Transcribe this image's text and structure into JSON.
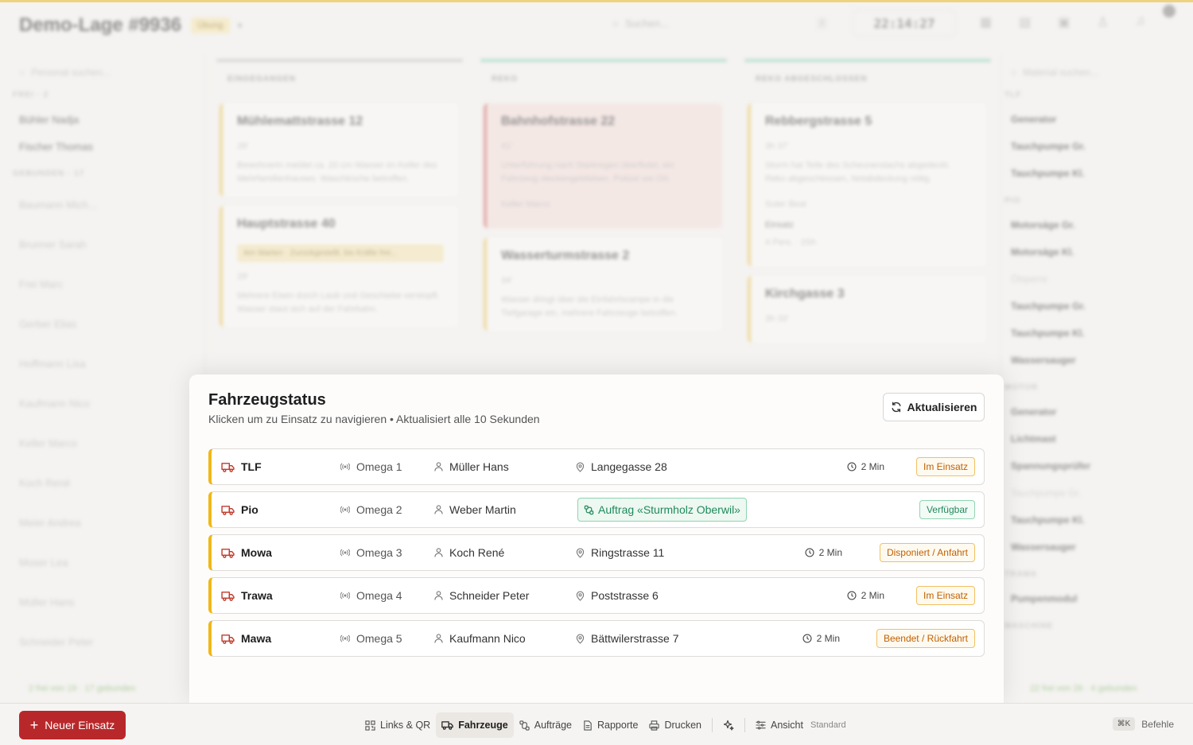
{
  "background": {
    "title": "Demo-Lage #9936",
    "badge": "Übung",
    "search_placeholder": "Suchen...",
    "clock": "22:14:27",
    "personnel_search": "Personal suchen...",
    "material_search": "Material suchen...",
    "sections": [
      "FREI · 2",
      "GEBUNDEN · 17"
    ],
    "free_people": [
      "Bühler Nadja",
      "Fischer Thomas"
    ],
    "bound_people": [
      "Baumann Mich...",
      "Brunner Sarah",
      "Frei Marc",
      "Gerber Elias",
      "Hoffmann Lisa",
      "Kaufmann Nico",
      "Keller Marco",
      "Koch René",
      "Meier Andrea",
      "Moser Lea",
      "Müller Hans",
      "Schneider Peter"
    ],
    "left_footer": "2 frei von 19 · 17 gebunden",
    "columns": [
      {
        "title": "EINGEGANGEN",
        "cards": [
          {
            "title": "Mühlemattstrasse 12",
            "meta": "28'",
            "text": "Bewohnerin meldet ca. 20 cm Wasser im Keller des Mehrfamilienhauses. Waschküche betroffen."
          },
          {
            "title": "Hauptstrasse 40",
            "warn": "Am Warten · Zurückgestellt, bis Kräfte frei...",
            "meta": "29'",
            "text": "Mehrere Eisen durch Laub und Geschiebe verstopft. Wasser staut sich auf der Fahrbahn."
          }
        ]
      },
      {
        "title": "REKO",
        "cards": [
          {
            "title": "Bahnhofstrasse 22",
            "meta": "41'",
            "text": "Unterführung nach Starkregen überflutet, ein Fahrzeug steckengeblieben. Polizei vor Ort.",
            "person": "Keller Marco"
          },
          {
            "title": "Wasserturmstrasse 2",
            "meta": "34'",
            "text": "Wasser dringt über die Einfahrtsrampe in die Tiefgarage ein, mehrere Fahrzeuge betroffen."
          }
        ]
      },
      {
        "title": "REKO ABGESCHLOSSEN",
        "cards": [
          {
            "title": "Rebbergstrasse 5",
            "meta": "3h 37'",
            "text": "Sturm hat Teile des Scheunendachs abgedeckt. Reko abgeschlossen, Notabdeckung nötig.",
            "person": "Suter Beat",
            "extra": "Einsatz",
            "extra_sub": "4 Pers. · 2Sh"
          },
          {
            "title": "Kirchgasse 3",
            "meta": "3h 33'"
          }
        ]
      }
    ],
    "right_sections": [
      "TLF",
      "PIO",
      "MOTOR",
      "TRAWA",
      "MASCHINE"
    ],
    "material_groups": [
      [
        "Generator",
        "Tauchpumpe Gr.",
        "Tauchpumpe Kl."
      ],
      [
        "Motorsäge Gr.",
        "Motorsäge Kl.",
        "Ölsperre",
        "Tauchpumpe Gr.",
        "Tauchpumpe Kl.",
        "Wassersauger"
      ],
      [
        "Generator",
        "Lichtmast",
        "Spannungsprüfer",
        "Tauchpumpe Gr.",
        "Tauchpumpe Kl.",
        "Wassersauger"
      ],
      [
        "Pumpenmodul"
      ]
    ],
    "right_footer": "22 frei von 26 · 4 gebunden"
  },
  "modal": {
    "title": "Fahrzeugstatus",
    "subtitle": "Klicken um zu Einsatz zu navigieren • Aktualisiert alle 10 Sekunden",
    "refresh_label": "Aktualisieren",
    "vehicles": [
      {
        "name": "TLF",
        "radio": "Omega 1",
        "person": "Müller Hans",
        "location": "Langegasse 28",
        "time": "2 Min",
        "status": "Im Einsatz",
        "status_color": "#c06000"
      },
      {
        "name": "Pio",
        "radio": "Omega 2",
        "person": "Weber Martin",
        "auftrag": "Auftrag «Sturmholz Oberwil»",
        "status": "Verfügbar",
        "status_color": "#1f8a5a"
      },
      {
        "name": "Mowa",
        "radio": "Omega 3",
        "person": "Koch René",
        "location": "Ringstrasse 11",
        "time": "2 Min",
        "status": "Disponiert / Anfahrt",
        "status_color": "#c06000"
      },
      {
        "name": "Trawa",
        "radio": "Omega 4",
        "person": "Schneider Peter",
        "location": "Poststrasse 6",
        "time": "2 Min",
        "status": "Im Einsatz",
        "status_color": "#c06000"
      },
      {
        "name": "Mawa",
        "radio": "Omega 5",
        "person": "Kaufmann Nico",
        "location": "Bättwilerstrasse 7",
        "time": "2 Min",
        "status": "Beendet / Rückfahrt",
        "status_color": "#c06000"
      }
    ]
  },
  "bottombar": {
    "new_button": "Neuer Einsatz",
    "nav": {
      "links": "Links & QR",
      "vehicles": "Fahrzeuge",
      "orders": "Aufträge",
      "reports": "Rapporte",
      "print": "Drucken",
      "view": "Ansicht",
      "view_mode": "Standard"
    },
    "shortcut": "⌘K",
    "commands": "Befehle"
  },
  "colors": {
    "accent": "#e8b010",
    "primary_button": "#b8282a",
    "row_accent": "#f0b818",
    "available": "#1f8a5a",
    "busy": "#c06000"
  }
}
